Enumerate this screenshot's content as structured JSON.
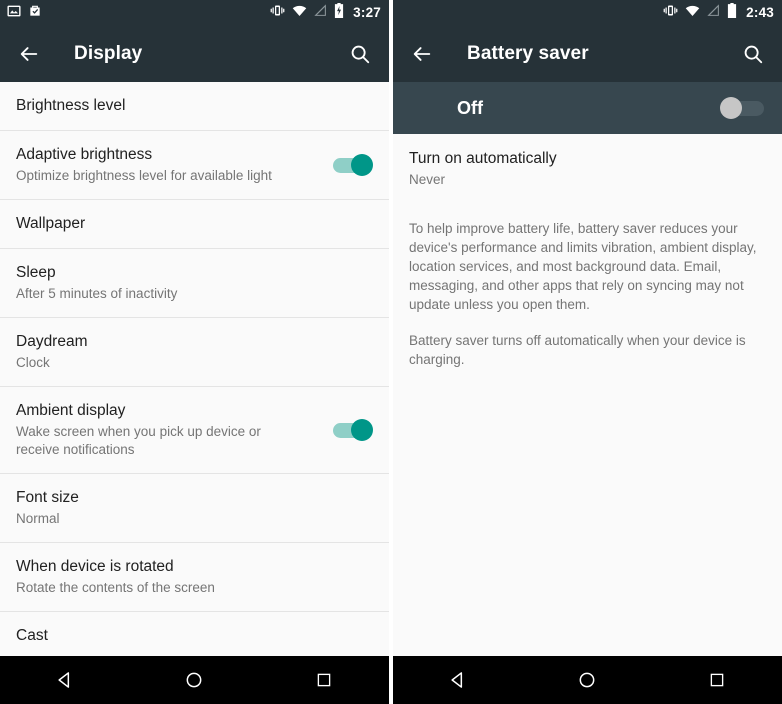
{
  "colors": {
    "app_bar": "#263238",
    "status_bar": "#263238",
    "switch_band": "#37474f",
    "list_bg": "#fafafa",
    "divider": "#e4e4e4",
    "title_text": "#212121",
    "secondary_text": "#757575",
    "toggle_on_thumb": "#009688",
    "toggle_on_track": "#8fcfc7",
    "toggle_off_thumb": "#c6c6c6",
    "toggle_off_track": "#4a5a62",
    "nav_bar": "#000000"
  },
  "left_screen": {
    "status_bar": {
      "clock": "3:27",
      "left_icons": [
        "image-icon",
        "screenshot-icon"
      ],
      "right_icons": [
        "vibrate-icon",
        "wifi-icon",
        "no-signal-icon",
        "battery-charging-icon"
      ]
    },
    "app_bar": {
      "back_label": "back-arrow-icon",
      "title": "Display",
      "search_label": "search-icon"
    },
    "items": [
      {
        "title": "Brightness level",
        "subtitle": "",
        "toggle": null
      },
      {
        "title": "Adaptive brightness",
        "subtitle": "Optimize brightness level for available light",
        "toggle": "on"
      },
      {
        "title": "Wallpaper",
        "subtitle": "",
        "toggle": null
      },
      {
        "title": "Sleep",
        "subtitle": "After 5 minutes of inactivity",
        "toggle": null
      },
      {
        "title": "Daydream",
        "subtitle": "Clock",
        "toggle": null
      },
      {
        "title": "Ambient display",
        "subtitle": "Wake screen when you pick up device or receive notifications",
        "toggle": "on"
      },
      {
        "title": "Font size",
        "subtitle": "Normal",
        "toggle": null
      },
      {
        "title": "When device is rotated",
        "subtitle": "Rotate the contents of the screen",
        "toggle": null
      },
      {
        "title": "Cast",
        "subtitle": "",
        "toggle": null
      }
    ],
    "nav_bar": {
      "back": "back-triangle-icon",
      "home": "home-circle-icon",
      "recents": "recents-square-icon"
    }
  },
  "right_screen": {
    "status_bar": {
      "clock": "2:43",
      "left_icons": [],
      "right_icons": [
        "vibrate-icon",
        "wifi-icon",
        "no-signal-icon",
        "battery-full-icon"
      ]
    },
    "app_bar": {
      "back_label": "back-arrow-icon",
      "title": "Battery saver",
      "search_label": "search-icon"
    },
    "master_switch": {
      "label": "Off",
      "state": "off"
    },
    "setting": {
      "title": "Turn on automatically",
      "subtitle": "Never"
    },
    "paragraphs": [
      "To help improve battery life, battery saver reduces your device's performance and limits vibration, ambient display, location services, and most background data. Email, messaging, and other apps that rely on syncing may not update unless you open them.",
      "Battery saver turns off automatically when your device is charging."
    ],
    "nav_bar": {
      "back": "back-triangle-icon",
      "home": "home-circle-icon",
      "recents": "recents-square-icon"
    }
  }
}
